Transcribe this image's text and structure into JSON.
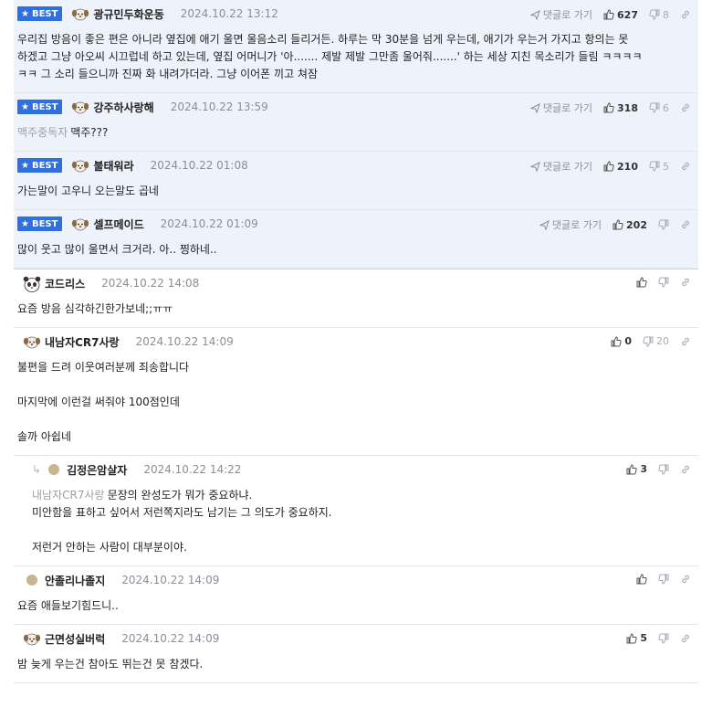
{
  "labels": {
    "best": "BEST",
    "goto": "댓글로 가기"
  },
  "comments": [
    {
      "best": true,
      "author": "광규민두화운동",
      "date": "2024.10.22 13:12",
      "likes": "627",
      "dislikes": "8",
      "lines": [
        "우리집 방음이 좋은 편은 아니라 옆집에 애기 울면 울음소리 들리거든. 하루는 막 30분을 넘게 우는데, 애기가 우는거 가지고 항의는 못",
        "하겠고 그냥 아오씨 시끄럽네 하고 있는데, 옆집 어머니가 '아....... 제발 제발 그만좀 울어줘.......' 하는 세상 지친 목소리가 들림 ㅋㅋㅋㅋ",
        "ㅋㅋ 그 소리 들으니까 진짜 화 내려가더라. 그냥 이어폰 끼고 쳐잠"
      ]
    },
    {
      "best": true,
      "author": "강주하사랑해",
      "date": "2024.10.22 13:59",
      "likes": "318",
      "dislikes": "6",
      "mention": "맥주중독자",
      "lines": [
        "맥주???"
      ]
    },
    {
      "best": true,
      "author": "불태워라",
      "date": "2024.10.22 01:08",
      "likes": "210",
      "dislikes": "5",
      "lines": [
        "가는말이 고우니 오는말도 곱네"
      ]
    },
    {
      "best": true,
      "author": "셀프메이드",
      "date": "2024.10.22 01:09",
      "likes": "202",
      "dislikes": "",
      "lines": [
        "많이 웃고 많이 울면서 크거라. 아.. 찡하네.."
      ]
    },
    {
      "best": false,
      "author": "코드리스",
      "date": "2024.10.22 14:08",
      "likes": "",
      "dislikes": "",
      "lines": [
        "요즘 방음 심각하긴한가보네;;ㅠㅠ"
      ]
    },
    {
      "best": false,
      "author": "내남자CR7사랑",
      "date": "2024.10.22 14:09",
      "likes": "0",
      "dislikes": "20",
      "lines": [
        "불편을 드려 이웃여러분께 죄송합니다",
        "",
        "마지막에 이런걸 써줘야 100점인데",
        "",
        "솔까 아쉽네"
      ]
    },
    {
      "best": false,
      "reply": true,
      "author": "김정은암살자",
      "date": "2024.10.22 14:22",
      "likes": "3",
      "dislikes": "",
      "mention": "내남자CR7사랑",
      "lines": [
        "문장의 완성도가 뭐가 중요하냐.",
        "미안함을 표하고 싶어서 저런쪽지라도 남기는 그 의도가 중요하지.",
        "",
        "저런거 안하는 사람이 대부분이야."
      ]
    },
    {
      "best": false,
      "author": "안졸리나졸지",
      "date": "2024.10.22 14:09",
      "likes": "",
      "dislikes": "",
      "lines": [
        "요즘 애들보기힘드니.."
      ]
    },
    {
      "best": false,
      "author": "근면성실버럭",
      "date": "2024.10.22 14:09",
      "likes": "5",
      "dislikes": "",
      "lines": [
        "밤 늦게 우는건 참아도 뛰는건 못 참겠다."
      ]
    }
  ]
}
